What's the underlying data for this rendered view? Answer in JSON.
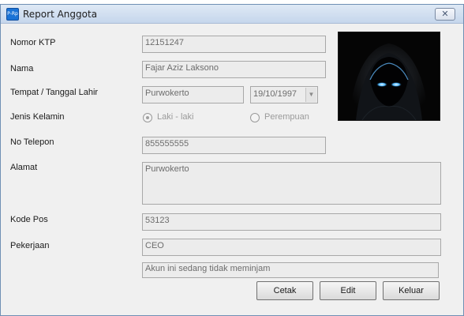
{
  "window": {
    "title": "Report Anggota",
    "icon_text": "P-Rp",
    "close_symbol": "✕"
  },
  "form": {
    "nomor_ktp": {
      "label": "Nomor KTP",
      "value": "12151247"
    },
    "nama": {
      "label": "Nama",
      "value": "Fajar Aziz Laksono"
    },
    "ttl": {
      "label": "Tempat / Tanggal Lahir",
      "tempat": "Purwokerto",
      "tanggal": "19/10/1997"
    },
    "jenis_kelamin": {
      "label": "Jenis Kelamin",
      "options": [
        {
          "label": "Laki - laki",
          "checked": true
        },
        {
          "label": "Perempuan",
          "checked": false
        }
      ]
    },
    "no_telepon": {
      "label": "No Telepon",
      "value": "855555555"
    },
    "alamat": {
      "label": "Alamat",
      "value": "Purwokerto"
    },
    "kode_pos": {
      "label": "Kode Pos",
      "value": "53123"
    },
    "pekerjaan": {
      "label": "Pekerjaan",
      "value": "CEO"
    },
    "status": "Akun ini sedang tidak meminjam"
  },
  "buttons": {
    "cetak": "Cetak",
    "edit": "Edit",
    "keluar": "Keluar"
  },
  "icons": {
    "app": "app-icon",
    "close": "close-icon",
    "dropdown": "chevron-down-icon"
  }
}
